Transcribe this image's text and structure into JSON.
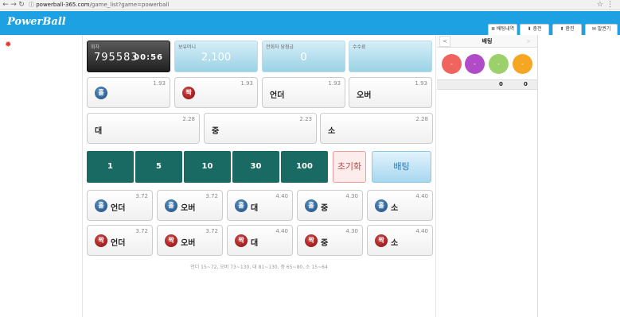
{
  "browser": {
    "url_host": "powerball-365.com",
    "url_path": "/game_list?game=powerball",
    "back_icon": "arrow-left-icon",
    "forward_icon": "arrow-right-icon",
    "reload_icon": "reload-icon",
    "info_icon": "info-icon",
    "star_icon": "star-icon",
    "menu_icon": "kebab-menu-icon"
  },
  "header": {
    "logo": "PowerBall",
    "buttons": [
      {
        "icon": "≣",
        "label": "배팅내역"
      },
      {
        "icon": "⬇",
        "label": "충전"
      },
      {
        "icon": "⬆",
        "label": "환전"
      },
      {
        "icon": "✉",
        "label": "발권기"
      }
    ],
    "accent": "#1da1e3"
  },
  "sidebar": {
    "sun_icon": "✹"
  },
  "info": {
    "round": {
      "label": "회차",
      "value": "795583",
      "time": "00:56"
    },
    "balance": {
      "label": "보유머니",
      "value": "2,100"
    },
    "win": {
      "label": "전회차 당첨금",
      "value": "0"
    },
    "fee": {
      "label": "수수료",
      "value": ""
    }
  },
  "bets_row1": [
    {
      "ball": "홀",
      "color": "blue",
      "label": "",
      "odds": "1.93"
    },
    {
      "ball": "짝",
      "color": "red",
      "label": "",
      "odds": "1.93"
    },
    {
      "ball": "",
      "color": "",
      "label": "언더",
      "odds": "1.93"
    },
    {
      "ball": "",
      "color": "",
      "label": "오버",
      "odds": "1.93"
    }
  ],
  "bets_row2": [
    {
      "label": "대",
      "odds": "2.28"
    },
    {
      "label": "중",
      "odds": "2.23"
    },
    {
      "label": "소",
      "odds": "2.28"
    }
  ],
  "amounts": [
    "1",
    "5",
    "10",
    "30",
    "100"
  ],
  "reset_label": "초기화",
  "place_label": "배팅",
  "combo_odd": [
    {
      "ball": "홀",
      "label": "언더",
      "odds": "3.72"
    },
    {
      "ball": "홀",
      "label": "오버",
      "odds": "3.72"
    },
    {
      "ball": "홀",
      "label": "대",
      "odds": "4.40"
    },
    {
      "ball": "홀",
      "label": "중",
      "odds": "4.30"
    },
    {
      "ball": "홀",
      "label": "소",
      "odds": "4.40"
    }
  ],
  "combo_even": [
    {
      "ball": "짝",
      "label": "언더",
      "odds": "3.72"
    },
    {
      "ball": "짝",
      "label": "오버",
      "odds": "3.72"
    },
    {
      "ball": "짝",
      "label": "대",
      "odds": "4.40"
    },
    {
      "ball": "짝",
      "label": "중",
      "odds": "4.30"
    },
    {
      "ball": "짝",
      "label": "소",
      "odds": "4.40"
    }
  ],
  "range_note": "언더 15~72, 오버 73~130, 대 81~130, 중 65~80, 소 15~64",
  "right_panel": {
    "title": "배팅",
    "prev": "<",
    "next": ">",
    "balls": [
      {
        "label": "-",
        "color": "#f1635f"
      },
      {
        "label": "-",
        "color": "#b24bc7"
      },
      {
        "label": "-",
        "color": "#9bd06b"
      },
      {
        "label": "-",
        "color": "#f5a623"
      }
    ],
    "values": [
      "0",
      "0"
    ]
  }
}
